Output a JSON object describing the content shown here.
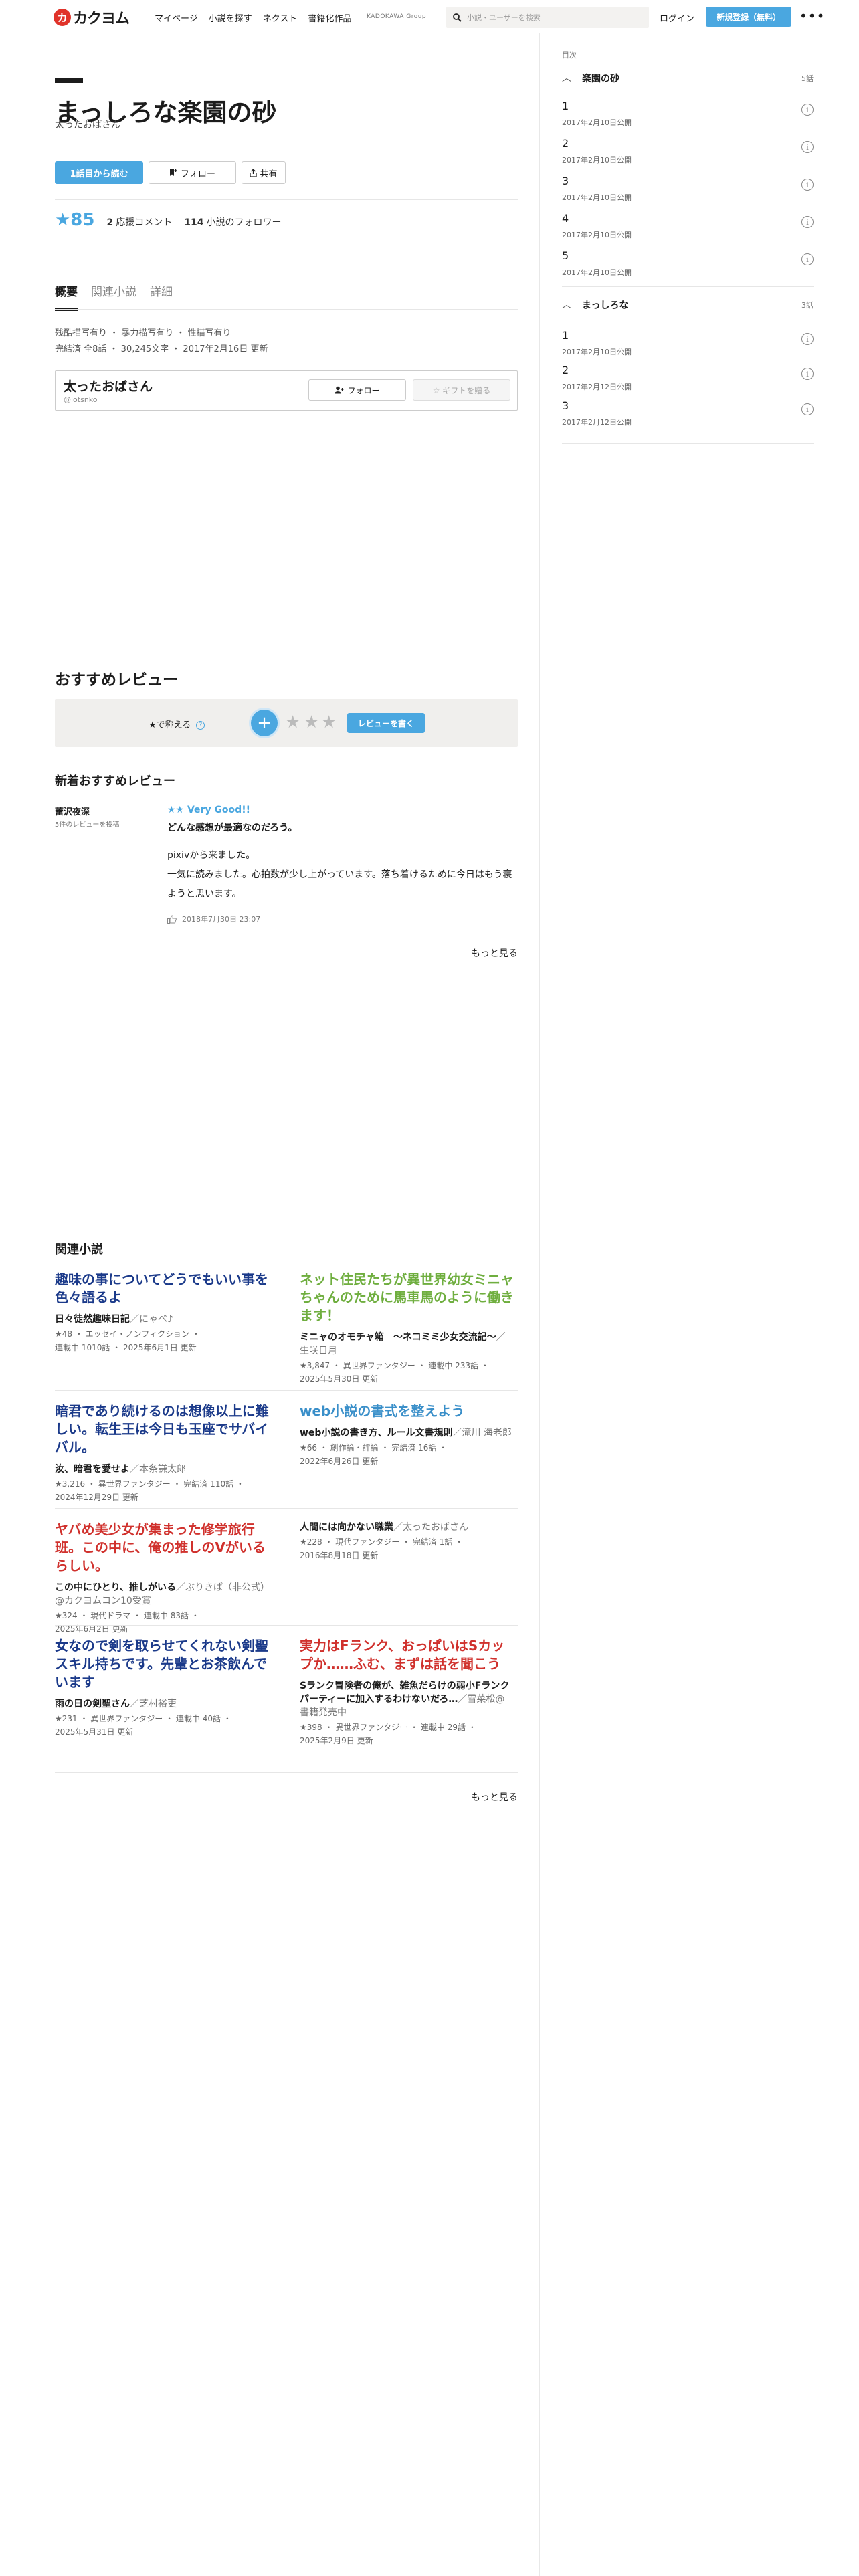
{
  "header": {
    "logo_mark": "カ",
    "logo_text": "カクヨム",
    "nav": [
      "マイページ",
      "小説を探す",
      "ネクスト",
      "書籍化作品"
    ],
    "group": "KADOKAWA Group",
    "search_placeholder": "小説・ユーザーを検索",
    "login": "ログイン",
    "signup": "新規登録（無料）",
    "more": "•••"
  },
  "work": {
    "title": "まっしろな楽園の砂",
    "author": "太ったおばさん",
    "read_first": "1話目から読む",
    "follow": "フォロー",
    "share": "共有",
    "score": "★85",
    "comments_num": "2",
    "comments_label": "応援コメント",
    "followers_num": "114",
    "followers_label": "小説のフォロワー"
  },
  "tabs": [
    "概要",
    "関連小説",
    "詳細"
  ],
  "tags_line1": "残酷描写有り ・ 暴力描写有り ・ 性描写有り",
  "tags_line2": "完結済 全8話 ・ 30,245文字 ・ 2017年2月16日 更新",
  "author_card": {
    "name": "太ったおばさん",
    "id": "@lotsnko",
    "follow": "フォロー",
    "gift": "☆ ギフトを贈る"
  },
  "recommend": {
    "title": "おすすめレビュー",
    "label": "★で称える",
    "plus": "+",
    "write": "レビューを書く"
  },
  "new_reviews": {
    "title": "新着おすすめレビュー",
    "user": "蕾沢夜深",
    "count": "5件のレビューを投稿",
    "rating": "★★ Very Good!!",
    "headline": "どんな感想が最適なのだろう。",
    "body1": "pixivから来ました。",
    "body2": "一気に読みました。心拍数が少し上がっています。落ち着けるために今日はもう寝ようと思います。",
    "date": "2018年7月30日 23:07",
    "more": "もっと見る"
  },
  "related": {
    "title": "関連小説",
    "more": "もっと見る",
    "items": [
      {
        "title": "趣味の事についてどうでもいい事を色々語るよ",
        "color": "#1b3a8a",
        "work": "日々徒然趣味日記",
        "author": "にゃべ♪",
        "meta1": "★48 ・ エッセイ・ノンフィクション ・",
        "meta2": "連載中 1010話 ・ 2025年6月1日 更新"
      },
      {
        "title": "ネット住民たちが異世界幼女ミニャちゃんのために馬車馬のように働きます！",
        "color": "#6fae3f",
        "work": "ミニャのオモチャ箱　〜ネコミミ少女交流記〜",
        "author": "生咲日月",
        "meta1": "★3,847 ・ 異世界ファンタジー ・ 連載中 233話 ・",
        "meta2": "2025年5月30日 更新"
      },
      {
        "title": "暗君であり続けるのは想像以上に難しい。転生王は今日も玉座でサバイバル。",
        "color": "#1b3a8a",
        "work": "汝、暗君を愛せよ",
        "author": "本条謙太郎",
        "meta1": "★3,216 ・ 異世界ファンタジー ・ 完結済 110話 ・",
        "meta2": "2024年12月29日 更新"
      },
      {
        "title": "web小説の書式を整えよう",
        "color": "#3a8fc9",
        "work": "web小説の書き方、ルール文書規則",
        "author": "滝川 海老郎",
        "meta1": "★66 ・ 創作論・評論 ・ 完結済 16話 ・",
        "meta2": "2022年6月26日 更新"
      },
      {
        "title": "ヤバめ美少女が集まった修学旅行班。この中に、俺の推しのVがいるらしい。",
        "color": "#d0312d",
        "work": "この中にひとり、推しがいる",
        "author": "ぶりきば（非公式）@カクヨムコン10受賞",
        "meta1": "★324 ・ 現代ドラマ ・ 連載中 83話 ・",
        "meta2": "2025年6月2日 更新"
      },
      {
        "title": "",
        "color": "#1c1c1c",
        "work": "人間には向かない職業",
        "author": "太ったおばさん",
        "meta1": "★228 ・ 現代ファンタジー ・ 完結済 1話 ・",
        "meta2": "2016年8月18日 更新"
      },
      {
        "title": "女なので剣を取らせてくれない剣聖スキル持ちです。先輩とお茶飲んでいます",
        "color": "#1b3a8a",
        "work": "雨の日の剣聖さん",
        "author": "芝村裕吏",
        "meta1": "★231 ・ 異世界ファンタジー ・ 連載中 40話 ・",
        "meta2": "2025年5月31日 更新"
      },
      {
        "title": "実力はFランク、おっぱいはSカップか……ふむ、まずは話を聞こう",
        "color": "#d0312d",
        "work": "Sランク冒険者の俺が、雑魚だらけの弱小Fランクパーティーに加入するわけないだろ…",
        "author": "雪菜松@書籍発売中",
        "meta1": "★398 ・ 異世界ファンタジー ・ 連載中 29話 ・",
        "meta2": "2025年2月9日 更新"
      }
    ]
  },
  "toc": {
    "label": "目次",
    "chapters": [
      {
        "name": "楽園の砂",
        "count": "5話",
        "episodes": [
          {
            "num": "1",
            "date": "2017年2月10日公開"
          },
          {
            "num": "2",
            "date": "2017年2月10日公開"
          },
          {
            "num": "3",
            "date": "2017年2月10日公開"
          },
          {
            "num": "4",
            "date": "2017年2月10日公開"
          },
          {
            "num": "5",
            "date": "2017年2月10日公開"
          }
        ]
      },
      {
        "name": "まっしろな",
        "count": "3話",
        "episodes": [
          {
            "num": "1",
            "date": "2017年2月10日公開"
          },
          {
            "num": "2",
            "date": "2017年2月12日公開"
          },
          {
            "num": "3",
            "date": "2017年2月12日公開"
          }
        ]
      }
    ]
  },
  "colors": {
    "accent": "#4aa7e0",
    "logo": "#e0332a"
  }
}
